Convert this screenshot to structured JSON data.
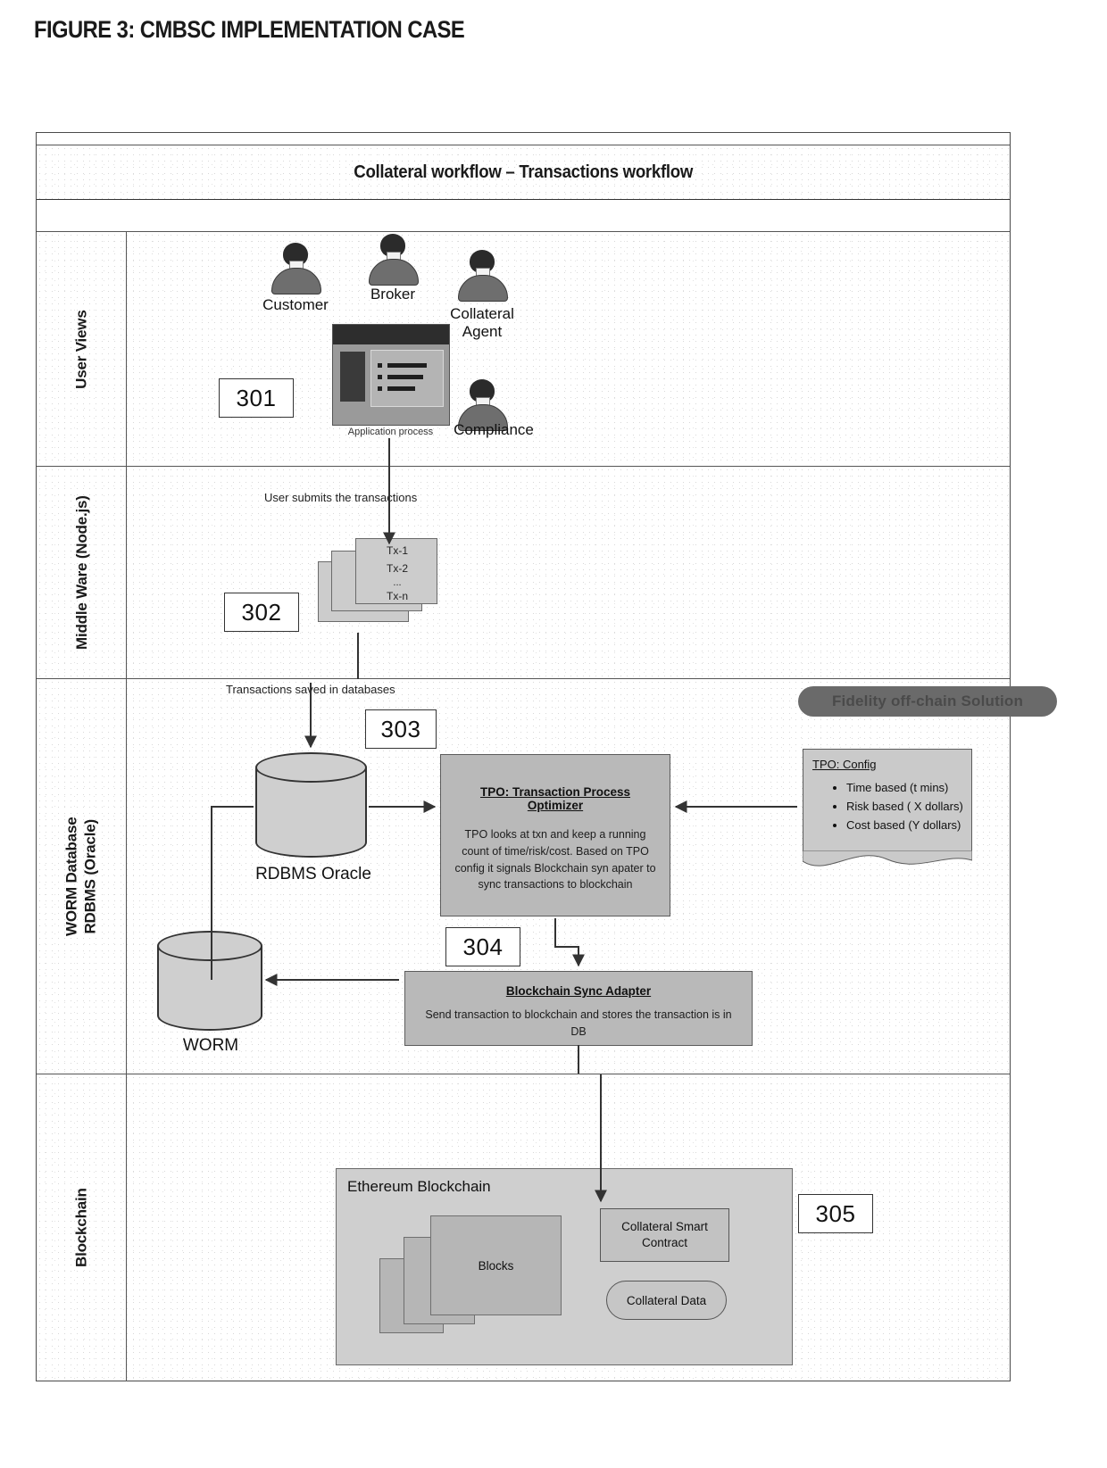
{
  "figure": {
    "title": "FIGURE 3: CMBSC IMPLEMENTATION CASE"
  },
  "banner": {
    "title": "Collateral workflow – Transactions workflow"
  },
  "lanes": [
    {
      "label": "User Views"
    },
    {
      "label": "Middle Ware (Node.js)"
    },
    {
      "label_line1": "WORM Database",
      "label_line2": "RDBMS (Oracle)"
    },
    {
      "label": "Blockchain"
    }
  ],
  "user_views": {
    "ref": "301",
    "actors": [
      {
        "name": "Customer"
      },
      {
        "name": "Broker"
      },
      {
        "name": "Collateral Agent"
      },
      {
        "name": "Compliance"
      }
    ],
    "app_caption": "Application process"
  },
  "middleware": {
    "ref": "302",
    "flow_label": "User submits the transactions",
    "transactions": [
      "Tx-1",
      "Tx-2",
      "...",
      "Tx-n"
    ]
  },
  "worm": {
    "flow_label": "Transactions saved in databases",
    "rdbms_label": "RDBMS Oracle",
    "worm_label": "WORM",
    "tpo": {
      "ref": "303",
      "title": "TPO: Transaction Process Optimizer",
      "body": "TPO looks at txn and keep a running count of time/risk/cost. Based on TPO config it signals Blockchain syn apater to sync transactions to blockchain"
    },
    "sync_adapter": {
      "ref": "304",
      "title": "Blockchain Sync Adapter",
      "body": "Send transaction to blockchain and stores the transaction is in DB"
    },
    "config_note": {
      "title": "TPO: Config",
      "items": [
        "Time based (t mins)",
        "Risk based ( X dollars)",
        "Cost based (Y dollars)"
      ]
    },
    "pill": {
      "label": "Fidelity off-chain Solution"
    }
  },
  "blockchain": {
    "ref": "305",
    "container_label": "Ethereum Blockchain",
    "blocks_label": "Blocks",
    "smart_contract": "Collateral Smart Contract",
    "collateral_data": "Collateral Data"
  },
  "colors": {
    "box_fill": "#b9b9b9",
    "note_fill": "#cacaca",
    "pill_fill": "#6a6a6a",
    "line": "#333333"
  }
}
